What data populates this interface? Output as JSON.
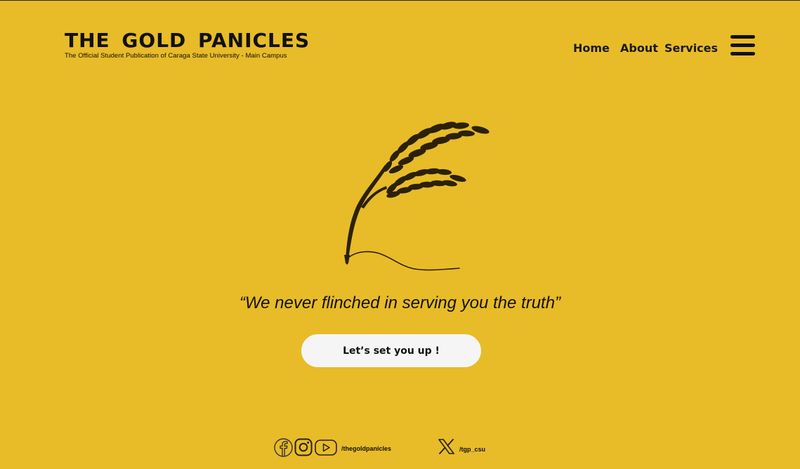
{
  "header": {
    "title": "THE GOLD PANICLES",
    "subtitle": "The Official Student Publication of Caraga State University - Main Campus"
  },
  "nav": {
    "home": "Home",
    "about": "About",
    "services": "Services"
  },
  "hero": {
    "tagline": "“We never flinched in serving you the truth”",
    "cta_label": "Let’s set you up !"
  },
  "social": {
    "icons": [
      "facebook-icon",
      "instagram-icon",
      "youtube-icon",
      "x-icon"
    ],
    "main_handle": "/thegoldpanicles",
    "x_handle": "/tgp_csu"
  },
  "colors": {
    "background": "#e8bb28",
    "text": "#111111",
    "button_bg": "#f5f5f5"
  }
}
